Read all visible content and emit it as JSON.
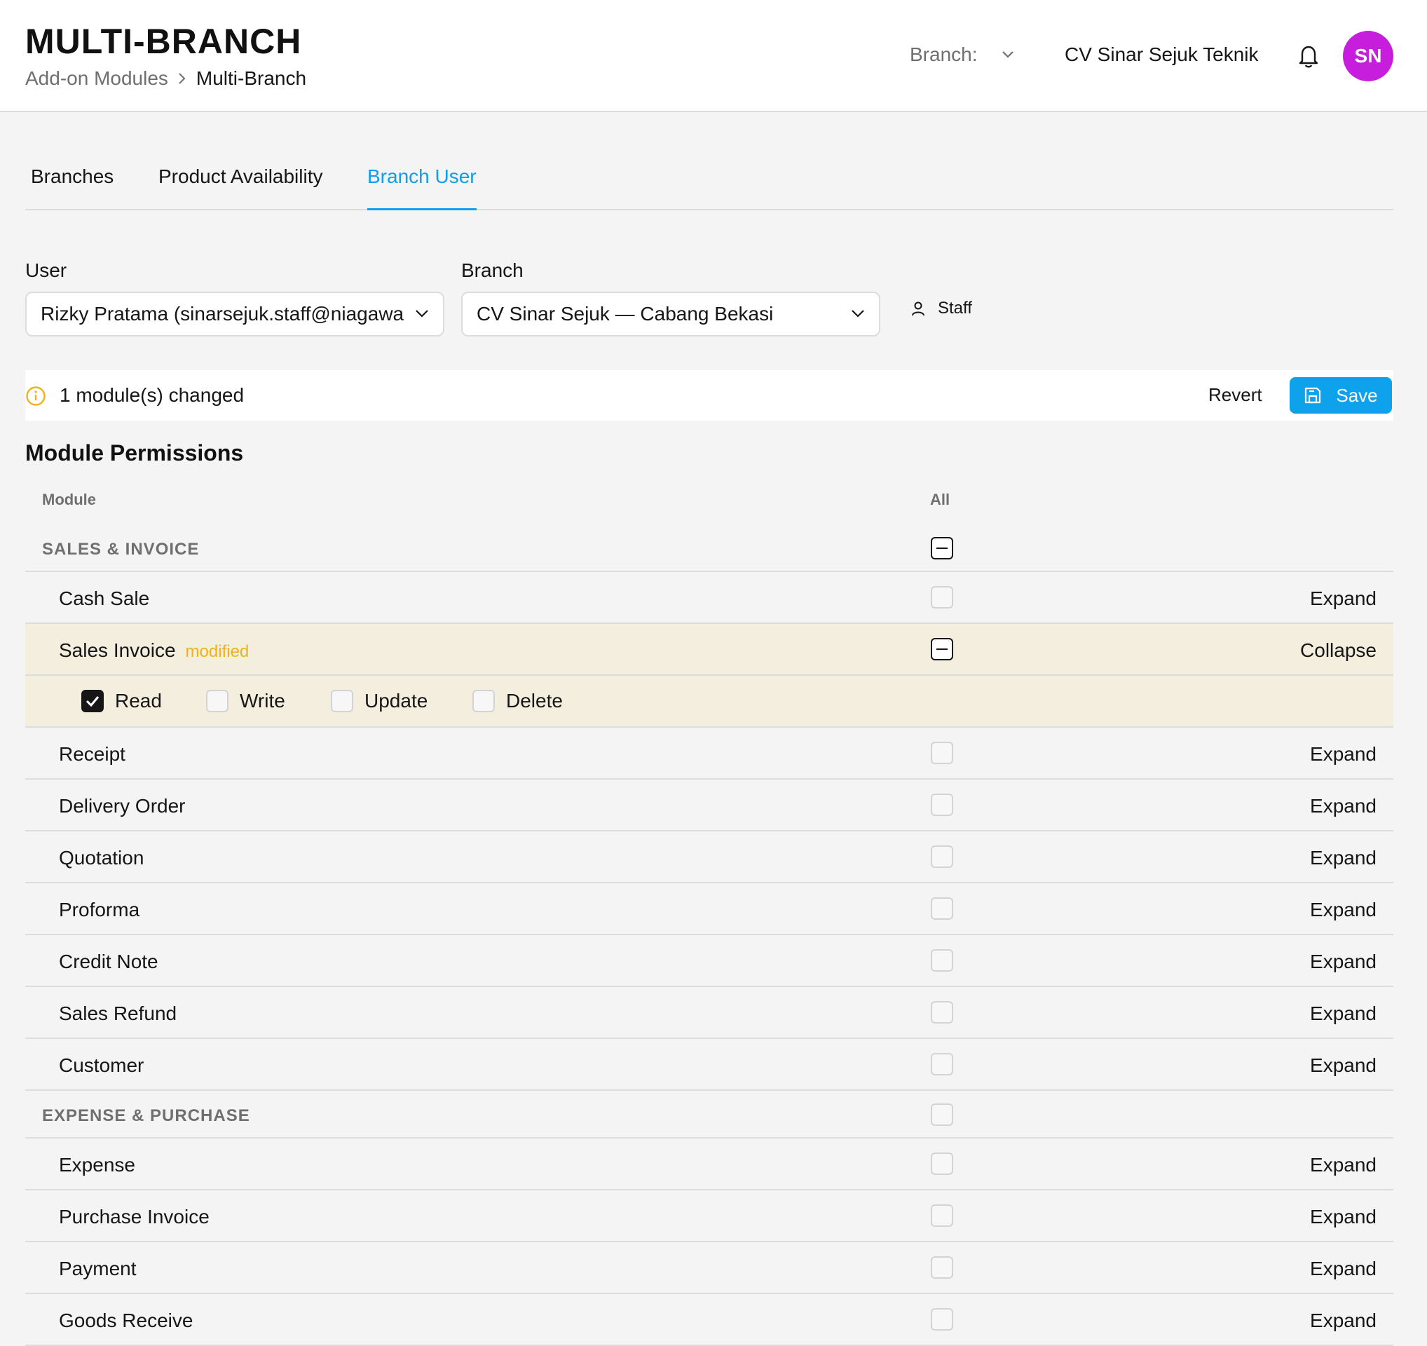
{
  "header": {
    "title": "MULTI-BRANCH",
    "breadcrumb": {
      "parent": "Add-on Modules",
      "current": "Multi-Branch"
    },
    "branch_label": "Branch:",
    "company": "CV Sinar Sejuk Teknik",
    "avatar_initials": "SN",
    "avatar_color": "#c71ede"
  },
  "tabs": [
    {
      "label": "Branches",
      "active": false
    },
    {
      "label": "Product Availability",
      "active": false
    },
    {
      "label": "Branch User",
      "active": true
    }
  ],
  "filters": {
    "user_label": "User",
    "user_value": "Rizky Pratama (sinarsejuk.staff@niagawa",
    "branch_label": "Branch",
    "branch_value": "CV Sinar Sejuk — Cabang Bekasi",
    "role": "Staff"
  },
  "changes": {
    "message": "1 module(s) changed",
    "revert_label": "Revert",
    "save_label": "Save",
    "accent_color": "#0fa2ec"
  },
  "permissions": {
    "title": "Module Permissions",
    "col_module": "Module",
    "col_all": "All",
    "groups": [
      {
        "name": "SALES & INVOICE",
        "state": "indeterminate",
        "modules": [
          {
            "name": "Cash Sale",
            "state": "unchecked",
            "action": "Expand"
          },
          {
            "name": "Sales Invoice",
            "state": "indeterminate",
            "action": "Collapse",
            "tag": "modified",
            "expanded": true,
            "perms": [
              {
                "label": "Read",
                "checked": true
              },
              {
                "label": "Write",
                "checked": false
              },
              {
                "label": "Update",
                "checked": false
              },
              {
                "label": "Delete",
                "checked": false
              }
            ]
          },
          {
            "name": "Receipt",
            "state": "unchecked",
            "action": "Expand"
          },
          {
            "name": "Delivery Order",
            "state": "unchecked",
            "action": "Expand"
          },
          {
            "name": "Quotation",
            "state": "unchecked",
            "action": "Expand"
          },
          {
            "name": "Proforma",
            "state": "unchecked",
            "action": "Expand"
          },
          {
            "name": "Credit Note",
            "state": "unchecked",
            "action": "Expand"
          },
          {
            "name": "Sales Refund",
            "state": "unchecked",
            "action": "Expand"
          },
          {
            "name": "Customer",
            "state": "unchecked",
            "action": "Expand"
          }
        ]
      },
      {
        "name": "EXPENSE & PURCHASE",
        "state": "unchecked",
        "modules": [
          {
            "name": "Expense",
            "state": "unchecked",
            "action": "Expand"
          },
          {
            "name": "Purchase Invoice",
            "state": "unchecked",
            "action": "Expand"
          },
          {
            "name": "Payment",
            "state": "unchecked",
            "action": "Expand"
          },
          {
            "name": "Goods Receive",
            "state": "unchecked",
            "action": "Expand"
          }
        ]
      }
    ]
  }
}
